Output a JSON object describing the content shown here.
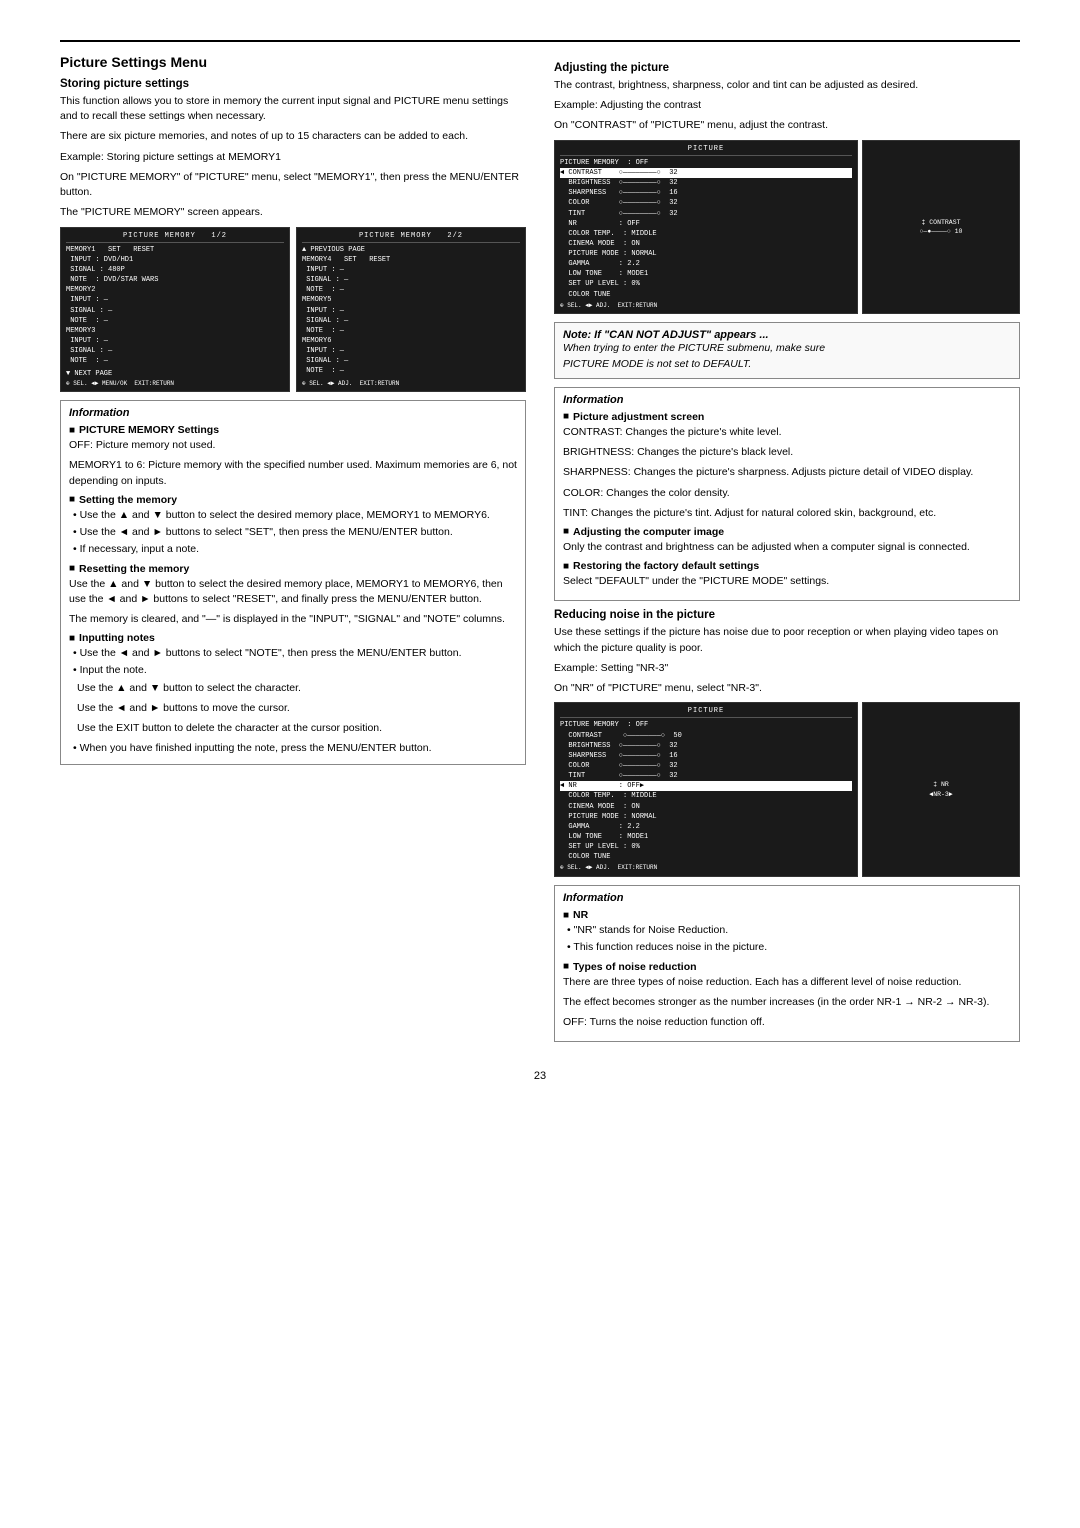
{
  "page": {
    "number": "23",
    "top_rule": true
  },
  "section": {
    "title": "Picture Settings Menu",
    "left_col": {
      "storing_title": "Storing picture settings",
      "storing_p1": "This function allows you to store in memory the current input signal and PICTURE menu settings and to recall these settings when necessary.",
      "storing_p2": "There are six picture memories, and notes of up to 15 characters can be added to each.",
      "storing_example": "Example: Storing picture settings at MEMORY1",
      "storing_p3": "On \"PICTURE MEMORY\" of \"PICTURE\" menu, select \"MEMORY1\", then press the MENU/ENTER button.",
      "storing_p4": "The \"PICTURE MEMORY\" screen appears.",
      "info_box": {
        "title": "Information",
        "picture_memory_head": "PICTURE MEMORY Settings",
        "off_label": "OFF: Picture memory not used.",
        "memory_label": "MEMORY1 to 6: Picture memory with the specified number used. Maximum memories are 6, not depending on inputs.",
        "setting_memory_head": "Setting the memory",
        "setting_bullets": [
          "Use the ▲ and ▼ button to select the desired memory place, MEMORY1 to MEMORY6.",
          "Use the ◄ and ► buttons to select \"SET\", then press the MENU/ENTER button.",
          "If necessary, input a note."
        ],
        "resetting_head": "Resetting the memory",
        "resetting_p1": "Use the ▲ and ▼ button to select the desired memory place, MEMORY1 to MEMORY6, then use the ◄ and ► buttons to select \"RESET\", and finally press the MENU/ENTER button.",
        "resetting_p2": "The memory is cleared, and \"—\" is displayed in the \"INPUT\", \"SIGNAL\" and \"NOTE\" columns.",
        "inputting_head": "Inputting notes",
        "inputting_bullets": [
          "Use the ◄ and ► buttons to select \"NOTE\", then press the MENU/ENTER button.",
          "Input the note.",
          "Use the ▲ and ▼ button to select the character.",
          "Use the ◄ and ► buttons to move the cursor.",
          "Use the EXIT button to delete the character at the cursor position.",
          "When you have finished inputting the note, press the MENU/ENTER button."
        ]
      }
    },
    "right_col": {
      "adjusting_title": "Adjusting the picture",
      "adjusting_p1": "The contrast, brightness, sharpness, color and tint can be adjusted as desired.",
      "adjusting_example": "Example: Adjusting the contrast",
      "adjusting_p2": "On \"CONTRAST\" of \"PICTURE\" menu, adjust the contrast.",
      "note_box": {
        "title": "Note:",
        "keyword": "Note:",
        "condition": "If \"CAN NOT ADJUST\" appears ...",
        "body_line1": "When trying to enter the PICTURE submenu, make sure",
        "body_line2": "PICTURE MODE is not set to DEFAULT."
      },
      "info_box2": {
        "title": "Information",
        "picture_adj_head": "Picture adjustment screen",
        "contrast_desc": "CONTRAST: Changes the picture's white level.",
        "brightness_desc": "BRIGHTNESS: Changes the picture's black level.",
        "sharpness_desc": "SHARPNESS: Changes the picture's sharpness. Adjusts picture detail of VIDEO display.",
        "color_desc": "COLOR: Changes the color density.",
        "tint_desc": "TINT: Changes the picture's tint. Adjust for natural colored skin, background, etc.",
        "computer_image_head": "Adjusting the computer image",
        "computer_image_p": "Only the contrast and brightness can be adjusted when a computer signal is connected.",
        "factory_head": "Restoring the factory default settings",
        "factory_p": "Select \"DEFAULT\" under the \"PICTURE MODE\" settings."
      },
      "reducing_title": "Reducing noise in the picture",
      "reducing_p1": "Use these settings if the picture has noise due to poor reception or when playing video tapes on which the picture quality is poor.",
      "reducing_example": "Example: Setting \"NR-3\"",
      "reducing_p2": "On \"NR\" of \"PICTURE\" menu, select \"NR-3\".",
      "info_box3": {
        "title": "Information",
        "nr_head": "NR",
        "nr_bullet1": "\"NR\" stands for Noise Reduction.",
        "nr_bullet2": "This function reduces noise in the picture.",
        "types_head": "Types of noise reduction",
        "types_p1": "There are three types of noise reduction. Each has a different level of noise reduction.",
        "types_p2": "The effect becomes stronger as the number increases (in the order NR-1 → NR-2 → NR-3).",
        "types_p3": "OFF: Turns the noise reduction function off."
      }
    }
  },
  "screens": {
    "memory_screen1_title": "PICTURE MEMORY    1/2",
    "memory_screen1_rows": [
      "MEMORY1   SET   RESET",
      " INPUT : DVD/HD1",
      " SIGNAL : 480P",
      " NOTE  : DVD/STAR WARS",
      "MEMORY2",
      " INPUT : —",
      " SIGNAL : —",
      " NOTE  : —",
      "MEMORY3",
      " INPUT : —",
      " SIGNAL : —",
      " NOTE  : —",
      "▼ NEXT PAGE",
      "⊕ SEL.  ◄► MENU/OK  EXIT:RETURN"
    ],
    "memory_screen2_title": "PICTURE MEMORY    2/2",
    "memory_screen2_rows": [
      "▲ PREVIOUS PAGE",
      "MEMORY4   SET   RESET",
      " INPUT : —",
      " SIGNAL : —",
      " NOTE  : —",
      "MEMORY5",
      " INPUT : —",
      " SIGNAL : —",
      " NOTE  : —",
      "MEMORY6",
      " INPUT : —",
      " SIGNAL : —",
      " NOTE  : —",
      "⊕ SEL.  ◄► ADJ.  EXIT:RETURN"
    ],
    "picture_screen_rows": [
      "PICTURE",
      "PICTURE MEMORY  : OFF",
      "◄ CONTRAST    ○————————○  32",
      " BRIGHTNESS   ○————————○  32",
      " SHARPNESS    ○————————○  16",
      " COLOR        ○————————○  32",
      " TINT         ○————————○  32",
      " NR           : OFF",
      " COLOR TEMP.  : MIDDLE",
      " CINEMA MODE  : ON",
      " PICTURE MODE : NORMAL",
      " GAMMA        : 2.2",
      " LOW TONE     : MODE1",
      " SET UP LEVEL : 0%",
      " COLOR TUNE",
      "⊕ SEL.  ◄► ADJ.  EXIT:RETURN"
    ],
    "contrast_side_label": "‡ CONTRAST  ○—●————○  10",
    "nr_screen_rows": [
      "PICTURE",
      "PICTURE MEMORY  : OFF",
      " CONTRAST     ○————————○  50",
      " BRIGHTNESS   ○————————○  32",
      " SHARPNESS    ○————————○  16",
      " COLOR        ○————————○  32",
      " TINT         ○————————○  32",
      "◄ NR          : OFF▶",
      " COLOR TEMP.  : MIDDLE",
      " CINEMA MODE  : ON",
      " PICTURE MODE : NORMAL",
      " GAMMA        : 2.2",
      " LOW TONE     : MODE1",
      " SET UP LEVEL : 0%",
      " COLOR TUNE",
      "⊕ SEL.  ◄► ADJ.  EXIT:RETURN"
    ],
    "nr_side_label": "‡ NR    ◄NR-3►"
  }
}
